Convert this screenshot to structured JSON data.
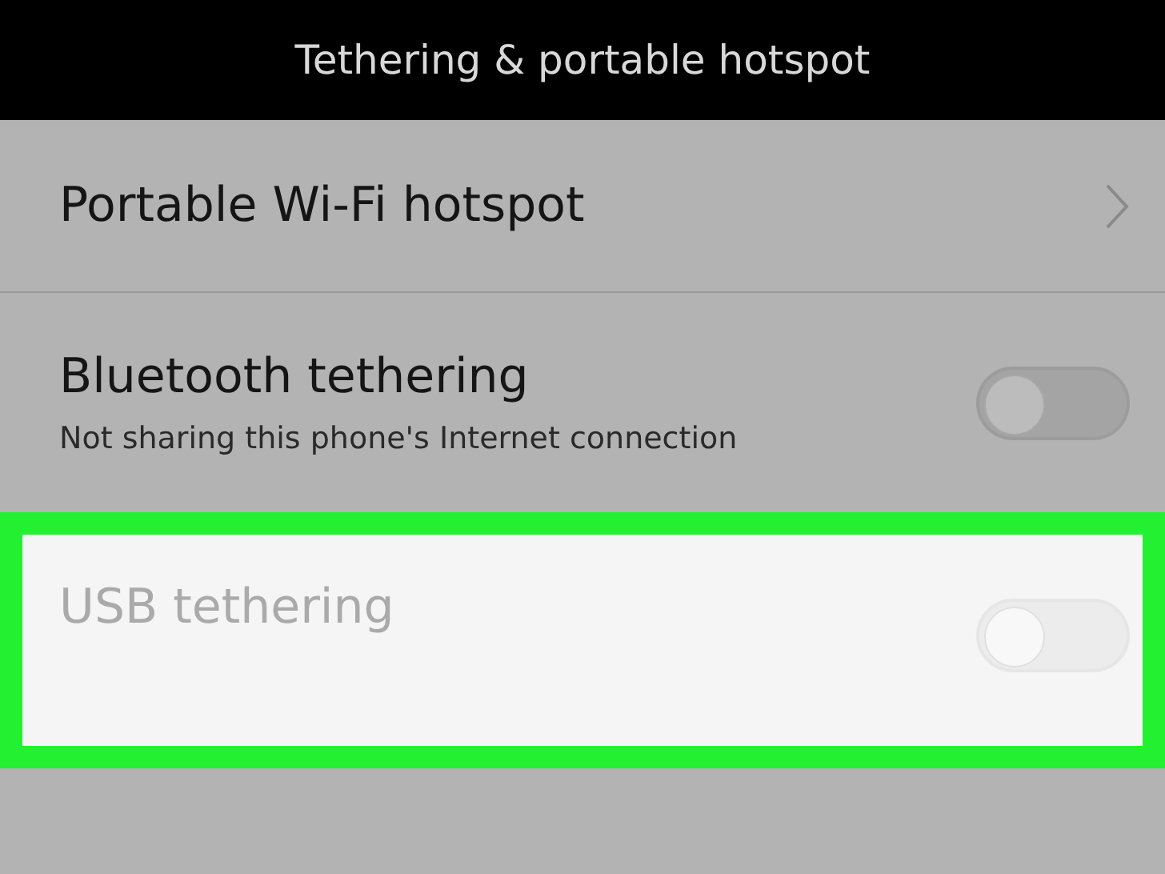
{
  "header": {
    "title": "Tethering & portable hotspot"
  },
  "items": [
    {
      "kind": "link",
      "title": "Portable Wi-Fi hotspot"
    },
    {
      "kind": "toggle",
      "title": "Bluetooth tethering",
      "subtitle": "Not sharing this phone's Internet connection",
      "on": false,
      "disabled": false,
      "highlighted": false
    },
    {
      "kind": "toggle",
      "title": "USB tethering",
      "on": false,
      "disabled": true,
      "highlighted": true
    }
  ]
}
